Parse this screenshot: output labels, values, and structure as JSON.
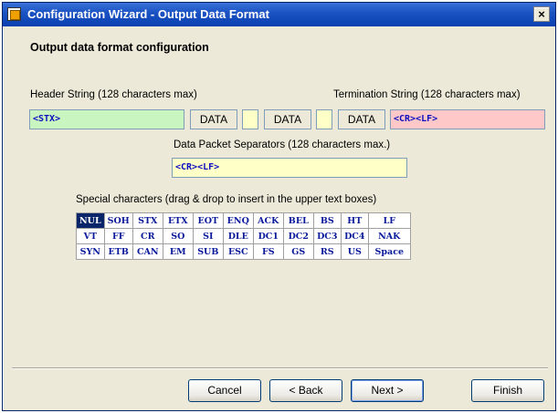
{
  "window": {
    "title": "Configuration Wizard - Output Data Format",
    "close_glyph": "×"
  },
  "heading": "Output data format configuration",
  "header_string": {
    "label": "Header String (128 characters max)",
    "value": "<STX>",
    "color": "#c8f5c0"
  },
  "termination_string": {
    "label": "Termination String (128 characters max)",
    "value": "<CR><LF>",
    "color": "#ffc8c8"
  },
  "data_fields": [
    "DATA",
    "DATA",
    "DATA"
  ],
  "packet_separators": {
    "label": "Data Packet Separators (128 characters max.)",
    "value": "<CR><LF>",
    "color": "#ffffc8"
  },
  "special_chars": {
    "label": "Special characters (drag & drop to insert in the upper text boxes)",
    "selected": "NUL",
    "rows": [
      [
        "NUL",
        "SOH",
        "STX",
        "ETX",
        "EOT",
        "ENQ",
        "ACK",
        "BEL",
        "BS",
        "HT",
        "LF"
      ],
      [
        "VT",
        "FF",
        "CR",
        "SO",
        "SI",
        "DLE",
        "DC1",
        "DC2",
        "DC3",
        "DC4",
        "NAK"
      ],
      [
        "SYN",
        "ETB",
        "CAN",
        "EM",
        "SUB",
        "ESC",
        "FS",
        "GS",
        "RS",
        "US",
        "Space"
      ]
    ]
  },
  "buttons": {
    "cancel": "Cancel",
    "back": "< Back",
    "next": "Next >",
    "finish": "Finish"
  }
}
